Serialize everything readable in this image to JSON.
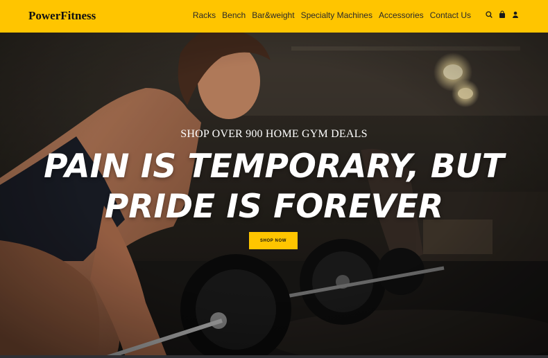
{
  "header": {
    "logo": "PowerFitness",
    "nav": [
      "Racks",
      "Bench",
      "Bar&weight",
      "Specialty Machines",
      "Accessories",
      "Contact Us"
    ],
    "icons": [
      "search-icon",
      "shopping-bag-icon",
      "user-icon"
    ],
    "background_color": "#ffc500"
  },
  "hero": {
    "kicker": "SHOP OVER 900 HOME GYM DEALS",
    "headline_line1": "PAIN IS TEMPORARY, BUT",
    "headline_line2": "PRIDE IS FOREVER",
    "cta_label": "SHOP NOW",
    "image": "hero-photo"
  }
}
